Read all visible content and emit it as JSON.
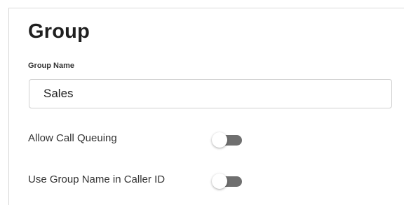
{
  "form": {
    "title": "Group",
    "group_name": {
      "label": "Group Name",
      "value": "Sales"
    },
    "settings": [
      {
        "label": "Allow Call Queuing",
        "enabled": false
      },
      {
        "label": "Use Group Name in Caller ID",
        "enabled": false
      }
    ]
  },
  "colors": {
    "toggle_off_track": "#6f6f6f",
    "toggle_thumb": "#ffffff",
    "border": "#cfcfcf"
  }
}
